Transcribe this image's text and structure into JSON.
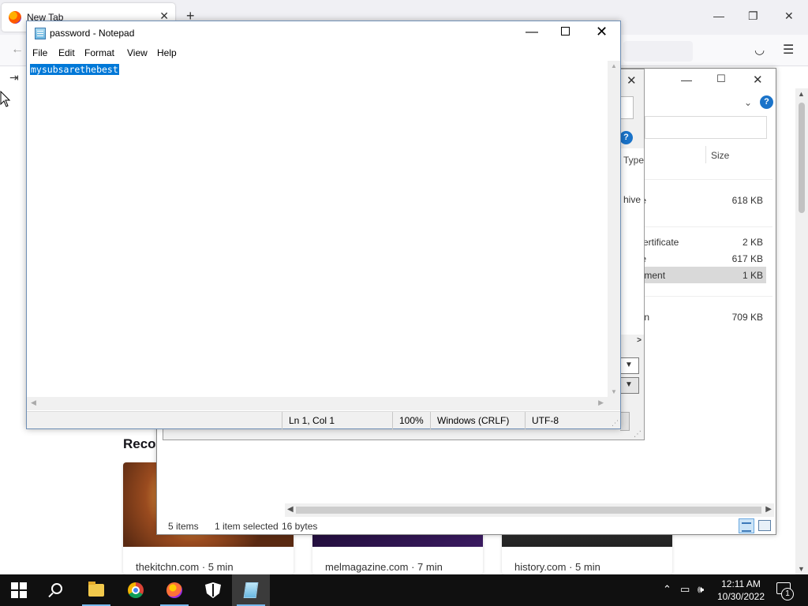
{
  "firefox": {
    "tab_title": "New Tab",
    "new_tab_glyph": "+",
    "recommended_heading": "Recom",
    "cards": [
      {
        "source": "thekitchn.com · 5 min",
        "image_color": "#b5652a"
      },
      {
        "source": "melmagazine.com · 7 min",
        "image_color": "#2a1040"
      },
      {
        "source": "history.com · 5 min",
        "image_color": "#3a3a3a"
      }
    ]
  },
  "explorer": {
    "column_size": "Size",
    "rows": [
      {
        "type": "hive",
        "size": "618 KB"
      },
      {
        "type": "y Certificate",
        "size": "2 KB"
      },
      {
        "type": "hive",
        "size": "617 KB"
      },
      {
        "type": "ocument",
        "size": "1 KB",
        "selected": true
      },
      {
        "type": "ation",
        "size": "709 KB"
      }
    ],
    "status": {
      "items": "5 items",
      "selected": "1 item selected",
      "size": "16 bytes"
    }
  },
  "dialog": {
    "column_type": "Type",
    "row_type": "hive"
  },
  "notepad": {
    "title": "password - Notepad",
    "menu": [
      "File",
      "Edit",
      "Format",
      "View",
      "Help"
    ],
    "content": "mysubsarethebest",
    "status": {
      "position": "Ln 1, Col 1",
      "zoom": "100%",
      "line_ending": "Windows (CRLF)",
      "encoding": "UTF-8"
    }
  },
  "taskbar": {
    "time": "12:11 AM",
    "date": "10/30/2022",
    "notification_count": "1"
  },
  "colors": {
    "selection": "#0078d7",
    "taskbar": "#101010",
    "accent_running": "#76b9ed"
  }
}
